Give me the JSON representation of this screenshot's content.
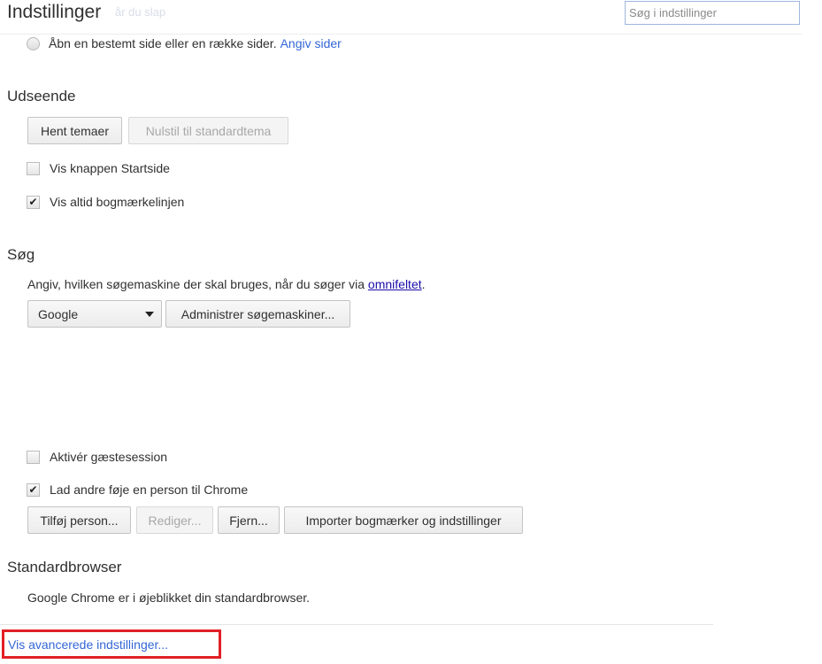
{
  "header": {
    "title": "Indstillinger",
    "ghost_text": "år du slap",
    "search_placeholder": "Søg i indstillinger"
  },
  "startup": {
    "radio_label": "Åbn en bestemt side eller en række sider.",
    "radio_link": "Angiv sider"
  },
  "appearance": {
    "title": "Udseende",
    "get_themes": "Hent temaer",
    "reset_theme": "Nulstil til standardtema",
    "show_home_label": "Vis knappen Startside",
    "show_home_checked": false,
    "show_bookmarks_label": "Vis altid bogmærkelinjen",
    "show_bookmarks_checked": true
  },
  "search": {
    "title": "Søg",
    "description": "Angiv, hvilken søgemaskine der skal bruges, når du søger via",
    "description_link": "omnifeltet",
    "description_end": ".",
    "engine_selected": "Google",
    "manage_button": "Administrer søgemaskiner..."
  },
  "people": {
    "guest_label": "Aktivér gæstesession",
    "guest_checked": false,
    "add_person_label": "Lad andre føje en person til Chrome",
    "add_person_checked": true,
    "add_button": "Tilføj person...",
    "edit_button": "Rediger...",
    "remove_button": "Fjern...",
    "import_button": "Importer bogmærker og indstillinger"
  },
  "default_browser": {
    "title": "Standardbrowser",
    "status": "Google Chrome er i øjeblikket din standardbrowser."
  },
  "footer": {
    "advanced_link": "Vis avancerede indstillinger..."
  },
  "colors": {
    "link": "#3367d6",
    "highlight_border": "#e21f26"
  }
}
